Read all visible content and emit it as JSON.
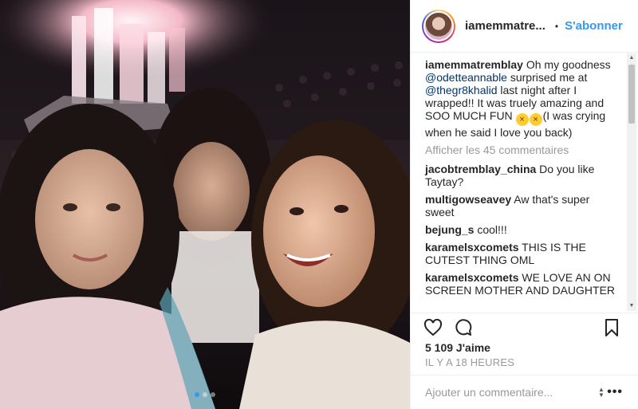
{
  "post": {
    "username": "iamemmatre...",
    "separator": "•",
    "follow_label": "S'abonner"
  },
  "caption": {
    "user": "iamemmatremblay",
    "text1": " Oh my goodness ",
    "mention1": "@odetteannable",
    "text2": " surprised me at ",
    "mention2": "@thegr8khalid",
    "text3": " last night after I wrapped!! It was truely amazing and SOO MUCH FUN ",
    "text4": "(I was crying when he said I love you back)"
  },
  "more_comments": "Afficher les 45 commentaires",
  "comments": [
    {
      "user": "jacobtremblay_china",
      "text": " Do you like Taytay?"
    },
    {
      "user": "multigowseavey",
      "text": " Aw that's super sweet"
    },
    {
      "user": "bejung_s",
      "text": " cool!!!"
    },
    {
      "user": "karamelsxcomets",
      "text": " THIS IS THE CUTEST THING OML"
    },
    {
      "user": "karamelsxcomets",
      "text": " WE LOVE AN ON SCREEN MOTHER AND DAUGHTER"
    }
  ],
  "likes": "5 109 J'aime",
  "timestamp": "IL Y A 18 HEURES",
  "add_comment_placeholder": "Ajouter un commentaire...",
  "more_options": "•••",
  "icons": {
    "like": "heart-outline-icon",
    "comment": "speech-bubble-icon",
    "save": "bookmark-icon",
    "emoji": "laughing-crying-emoji"
  },
  "carousel": {
    "count": 3,
    "active": 0
  },
  "colors": {
    "accent": "#3897f0",
    "text": "#262626",
    "muted": "#999999",
    "mention": "#003569"
  }
}
